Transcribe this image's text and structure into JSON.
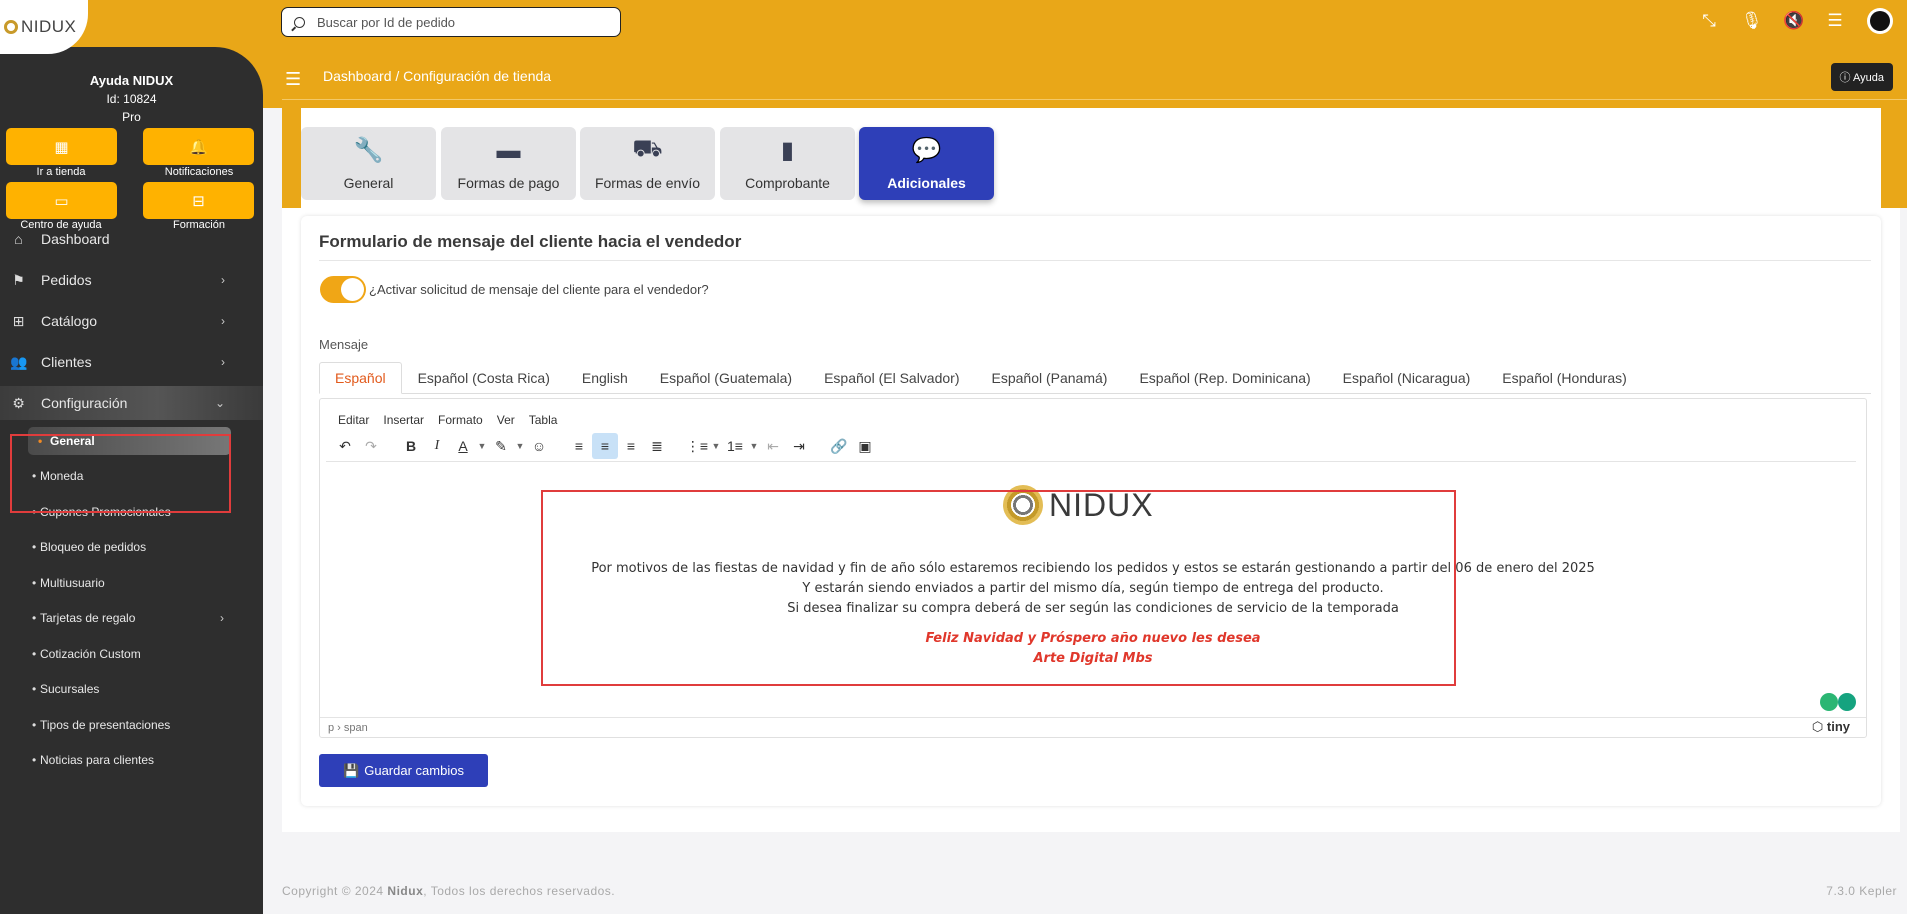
{
  "logo": {
    "text": "NIDUX"
  },
  "search": {
    "placeholder": "Buscar por Id de pedido"
  },
  "breadcrumb": {
    "root": "Dashboard",
    "sep": "/",
    "current": "Configuración de tienda"
  },
  "help_label": "Ayuda",
  "user": {
    "name": "Ayuda NIDUX",
    "id": "Id: 10824",
    "plan": "Pro"
  },
  "quick": [
    {
      "label": "Ir a tienda"
    },
    {
      "label": "Notificaciones"
    },
    {
      "label": "Centro de ayuda"
    },
    {
      "label": "Formación"
    }
  ],
  "nav": [
    {
      "label": "Dashboard"
    },
    {
      "label": "Pedidos"
    },
    {
      "label": "Catálogo"
    },
    {
      "label": "Clientes"
    },
    {
      "label": "Configuración"
    }
  ],
  "sub": [
    {
      "label": "General"
    },
    {
      "label": "Moneda"
    },
    {
      "label": "Cupones Promocionales"
    },
    {
      "label": "Bloqueo de pedidos"
    },
    {
      "label": "Multiusuario"
    },
    {
      "label": "Tarjetas de regalo"
    },
    {
      "label": "Cotización Custom"
    },
    {
      "label": "Sucursales"
    },
    {
      "label": "Tipos de presentaciones"
    },
    {
      "label": "Noticias para clientes"
    }
  ],
  "tabs": [
    {
      "label": "General"
    },
    {
      "label": "Formas de pago"
    },
    {
      "label": "Formas de envío"
    },
    {
      "label": "Comprobante"
    },
    {
      "label": "Adicionales"
    }
  ],
  "panel": {
    "title": "Formulario de mensaje del cliente hacia el vendedor",
    "toggle_label": "¿Activar solicitud de mensaje del cliente para el vendedor?",
    "message_label": "Mensaje",
    "save_label": "Guardar cambios"
  },
  "langs": [
    "Español",
    "Español (Costa Rica)",
    "English",
    "Español (Guatemala)",
    "Español (El Salvador)",
    "Español (Panamá)",
    "Español (Rep. Dominicana)",
    "Español (Nicaragua)",
    "Español (Honduras)"
  ],
  "editor": {
    "menu": [
      "Editar",
      "Insertar",
      "Formato",
      "Ver",
      "Tabla"
    ],
    "brand": "NIDUX",
    "line1": "Por motivos de las fiestas de navidad y fin de año sólo estaremos recibiendo los pedidos y estos se estarán gestionando a partir del 06 de enero del 2025",
    "line2": "Y estarán siendo enviados a partir del mismo día, según tiempo de entrega del producto.",
    "line3": "Si desea finalizar su compra deberá de ser según las condiciones de servicio de la temporada",
    "red1": "Feliz Navidad y Próspero año nuevo les desea",
    "red2": "Arte Digital Mbs",
    "path": "p › span",
    "tiny": "tiny"
  },
  "footer": {
    "prefix": "Copyright © 2024",
    "brand": "Nidux",
    "suffix": ", Todos los derechos reservados.",
    "version": "7.3.0 Kepler"
  },
  "colors": {
    "accent": "#e9a718",
    "primary": "#2e3fb8",
    "sidebar": "#2e2e2e",
    "highlight": "#e03c3c"
  }
}
